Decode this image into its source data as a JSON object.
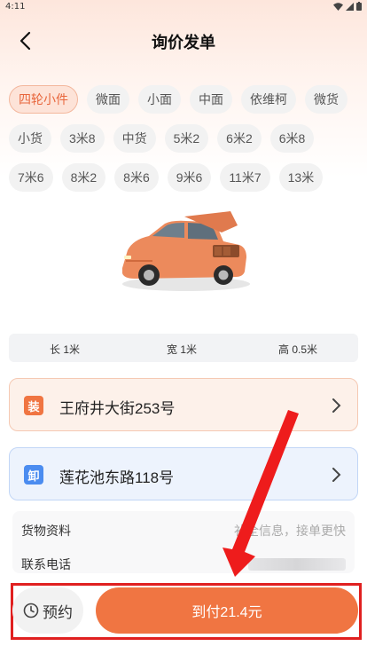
{
  "status_bar": {
    "time": "4:11"
  },
  "nav": {
    "title": "询价发单"
  },
  "vehicle_types": {
    "rows": [
      [
        "四轮小件",
        "微面",
        "小面",
        "中面",
        "依维柯",
        "微货"
      ],
      [
        "小货",
        "3米8",
        "中货",
        "5米2",
        "6米2",
        "6米8"
      ],
      [
        "7米6",
        "8米2",
        "8米6",
        "9米6",
        "11米7",
        "13米"
      ]
    ],
    "selected": "四轮小件"
  },
  "dimensions": {
    "length_label": "长",
    "length_value": "1米",
    "width_label": "宽",
    "width_value": "1米",
    "height_label": "高",
    "height_value": "0.5米"
  },
  "load_address": {
    "badge": "装",
    "text": "王府井大街253号"
  },
  "unload_address": {
    "badge": "卸",
    "text": "莲花池东路118号"
  },
  "cargo_info": {
    "label": "货物资料",
    "hint": "补全信息，接单更快"
  },
  "contact": {
    "label": "联系电话"
  },
  "bottom": {
    "reserve_label": "预约",
    "pay_label": "到付21.4元"
  },
  "colors": {
    "accent": "#f07542",
    "highlight_border": "#e02020",
    "blue_badge": "#4b8cf0"
  }
}
